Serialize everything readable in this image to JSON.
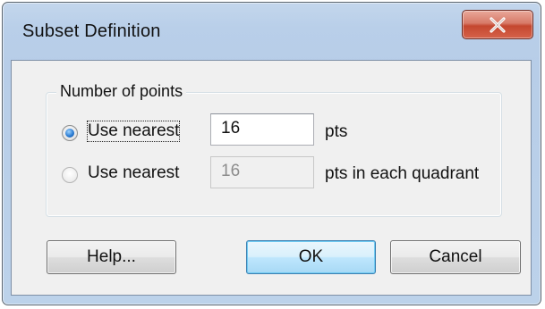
{
  "dialog": {
    "title": "Subset Definition",
    "close_icon": "close-x-icon"
  },
  "group": {
    "label": "Number of points",
    "options": [
      {
        "label": "Use nearest",
        "checked": true,
        "enabled": true,
        "value": "16",
        "suffix": "pts"
      },
      {
        "label": "Use nearest",
        "checked": false,
        "enabled": false,
        "value": "16",
        "suffix": "pts in each quadrant"
      }
    ]
  },
  "buttons": {
    "help": "Help...",
    "ok": "OK",
    "cancel": "Cancel"
  },
  "colors": {
    "title_bar": "#b9cfe9",
    "close_button": "#c4472f",
    "default_button": "#bee6fd"
  }
}
